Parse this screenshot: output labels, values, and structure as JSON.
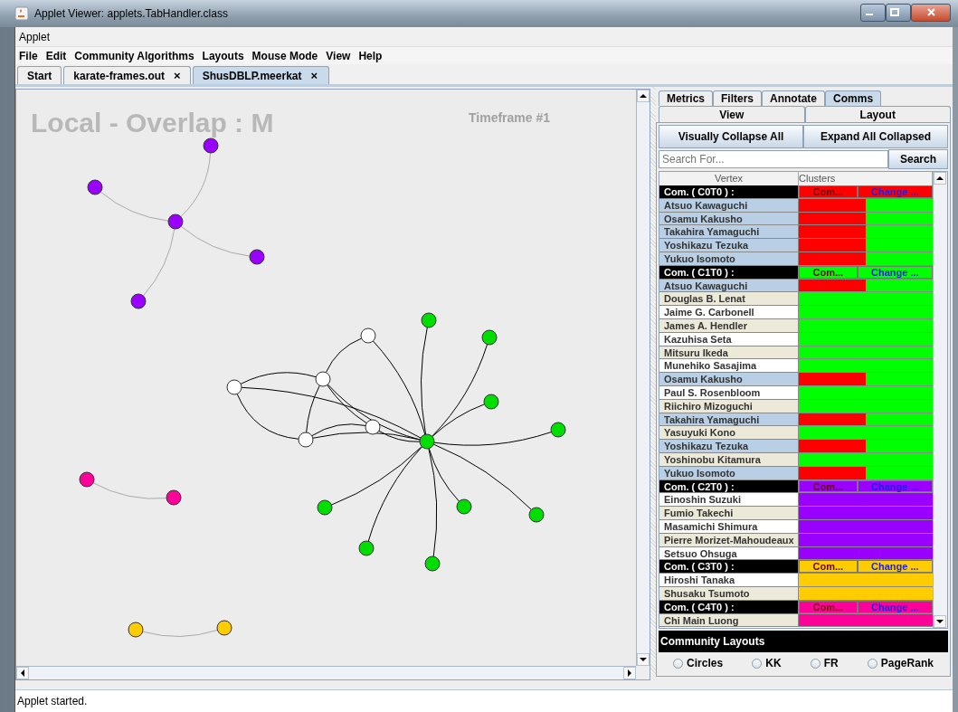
{
  "window": {
    "title": "Applet Viewer: applets.TabHandler.class"
  },
  "applet_menu": [
    "Applet"
  ],
  "menu": [
    "File",
    "Edit",
    "Community Algorithms",
    "Layouts",
    "Mouse Mode",
    "View",
    "Help"
  ],
  "tabs": [
    {
      "label": "Start",
      "closable": false,
      "selected": false
    },
    {
      "label": "karate-frames.out",
      "closable": true,
      "selected": false
    },
    {
      "label": "ShusDBLP.meerkat",
      "closable": true,
      "selected": true
    }
  ],
  "close_glyph": "×",
  "canvas": {
    "title": "Local - Overlap : M",
    "timeframe": "Timeframe #1"
  },
  "side_tabs": [
    {
      "label": "Metrics",
      "selected": false
    },
    {
      "label": "Filters",
      "selected": false
    },
    {
      "label": "Annotate",
      "selected": false
    },
    {
      "label": "Comms",
      "selected": true
    }
  ],
  "side_tabs_2": [
    {
      "label": "View",
      "selected": false
    },
    {
      "label": "Layout",
      "selected": false
    }
  ],
  "buttons": [
    "Visually Collapse All",
    "Expand All Collapsed"
  ],
  "search": {
    "placeholder": "Search For...",
    "button": "Search"
  },
  "table": {
    "columns": [
      "Vertex",
      "Clusters"
    ],
    "rows": [
      {
        "kind": "community",
        "label": "Com. ( C0T0 ) :",
        "color": "#ff0000",
        "com": "Com...",
        "change": "Change ..."
      },
      {
        "kind": "member",
        "name": "Atsuo Kawaguchi",
        "color": "#b8cfe5",
        "clusters": [
          {
            "color": "#ff0000"
          },
          {
            "color": "#00ff00"
          }
        ]
      },
      {
        "kind": "member",
        "name": "Osamu Kakusho",
        "color": "#b8cfe5",
        "clusters": [
          {
            "color": "#ff0000"
          },
          {
            "color": "#00ff00"
          }
        ]
      },
      {
        "kind": "member",
        "name": "Takahira Yamaguchi",
        "color": "#b8cfe5",
        "clusters": [
          {
            "color": "#ff0000"
          },
          {
            "color": "#00ff00"
          }
        ]
      },
      {
        "kind": "member",
        "name": "Yoshikazu Tezuka",
        "color": "#b8cfe5",
        "clusters": [
          {
            "color": "#ff0000"
          },
          {
            "color": "#00ff00"
          }
        ]
      },
      {
        "kind": "member",
        "name": "Yukuo Isomoto",
        "color": "#b8cfe5",
        "clusters": [
          {
            "color": "#ff0000"
          },
          {
            "color": "#00ff00"
          }
        ]
      },
      {
        "kind": "community",
        "label": "Com. ( C1T0 ) :",
        "color": "#00ff00",
        "com": "Com...",
        "change": "Change ..."
      },
      {
        "kind": "member",
        "name": "Atsuo Kawaguchi",
        "color": "#b8cfe5",
        "clusters": [
          {
            "color": "#ff0000"
          },
          {
            "color": "#00ff00"
          }
        ]
      },
      {
        "kind": "member",
        "name": "Douglas B. Lenat",
        "color": "#ece9d8",
        "clusters": [
          {
            "color": "#00ff00"
          }
        ]
      },
      {
        "kind": "member",
        "name": "Jaime G. Carbonell",
        "color": "#ffffff",
        "clusters": [
          {
            "color": "#00ff00"
          }
        ]
      },
      {
        "kind": "member",
        "name": "James A. Hendler",
        "color": "#ece9d8",
        "clusters": [
          {
            "color": "#00ff00"
          }
        ]
      },
      {
        "kind": "member",
        "name": "Kazuhisa Seta",
        "color": "#ffffff",
        "clusters": [
          {
            "color": "#00ff00"
          }
        ]
      },
      {
        "kind": "member",
        "name": "Mitsuru Ikeda",
        "color": "#ece9d8",
        "clusters": [
          {
            "color": "#00ff00"
          }
        ]
      },
      {
        "kind": "member",
        "name": "Munehiko Sasajima",
        "color": "#ffffff",
        "clusters": [
          {
            "color": "#00ff00"
          }
        ]
      },
      {
        "kind": "member",
        "name": "Osamu Kakusho",
        "color": "#b8cfe5",
        "clusters": [
          {
            "color": "#ff0000"
          },
          {
            "color": "#00ff00"
          }
        ]
      },
      {
        "kind": "member",
        "name": "Paul S. Rosenbloom",
        "color": "#ffffff",
        "clusters": [
          {
            "color": "#00ff00"
          }
        ]
      },
      {
        "kind": "member",
        "name": "Riichiro Mizoguchi",
        "color": "#ece9d8",
        "clusters": [
          {
            "color": "#00ff00"
          }
        ]
      },
      {
        "kind": "member",
        "name": "Takahira Yamaguchi",
        "color": "#b8cfe5",
        "clusters": [
          {
            "color": "#ff0000"
          },
          {
            "color": "#00ff00"
          }
        ]
      },
      {
        "kind": "member",
        "name": "Yasuyuki Kono",
        "color": "#ece9d8",
        "clusters": [
          {
            "color": "#00ff00"
          }
        ]
      },
      {
        "kind": "member",
        "name": "Yoshikazu Tezuka",
        "color": "#b8cfe5",
        "clusters": [
          {
            "color": "#ff0000"
          },
          {
            "color": "#00ff00"
          }
        ]
      },
      {
        "kind": "member",
        "name": "Yoshinobu Kitamura",
        "color": "#ece9d8",
        "clusters": [
          {
            "color": "#00ff00"
          }
        ]
      },
      {
        "kind": "member",
        "name": "Yukuo Isomoto",
        "color": "#b8cfe5",
        "clusters": [
          {
            "color": "#ff0000"
          },
          {
            "color": "#00ff00"
          }
        ]
      },
      {
        "kind": "community",
        "label": "Com. ( C2T0 ) :",
        "color": "#9900ff",
        "com": "Com...",
        "change": "Change ..."
      },
      {
        "kind": "member",
        "name": "Einoshin Suzuki",
        "color": "#ffffff",
        "clusters": [
          {
            "color": "#9900ff"
          }
        ]
      },
      {
        "kind": "member",
        "name": "Fumio Takechi",
        "color": "#ece9d8",
        "clusters": [
          {
            "color": "#9900ff"
          }
        ]
      },
      {
        "kind": "member",
        "name": "Masamichi Shimura",
        "color": "#ffffff",
        "clusters": [
          {
            "color": "#9900ff"
          }
        ]
      },
      {
        "kind": "member",
        "name": "Pierre Morizet-Mahoudeaux",
        "color": "#ece9d8",
        "clusters": [
          {
            "color": "#9900ff"
          }
        ]
      },
      {
        "kind": "member",
        "name": "Setsuo Ohsuga",
        "color": "#ffffff",
        "clusters": [
          {
            "color": "#9900ff"
          }
        ]
      },
      {
        "kind": "community",
        "label": "Com. ( C3T0 ) :",
        "color": "#ffcc00",
        "com": "Com...",
        "change": "Change ..."
      },
      {
        "kind": "member",
        "name": "Hiroshi Tanaka",
        "color": "#ffffff",
        "clusters": [
          {
            "color": "#ffcc00"
          }
        ]
      },
      {
        "kind": "member",
        "name": "Shusaku Tsumoto",
        "color": "#ece9d8",
        "clusters": [
          {
            "color": "#ffcc00"
          }
        ]
      },
      {
        "kind": "community",
        "label": "Com. ( C4T0 ) :",
        "color": "#ff0099",
        "com": "Com...",
        "change": "Change ..."
      },
      {
        "kind": "member",
        "name": "Chi Main Luong",
        "color": "#ece9d8",
        "clusters": [
          {
            "color": "#ff0099"
          }
        ]
      }
    ]
  },
  "community_layouts": {
    "title": "Community Layouts",
    "options": [
      {
        "label": "Circles",
        "selected": false
      },
      {
        "label": "KK",
        "selected": false
      },
      {
        "label": "FR",
        "selected": false
      },
      {
        "label": "PageRank",
        "selected": false
      }
    ]
  },
  "status_bar": "Applet started."
}
